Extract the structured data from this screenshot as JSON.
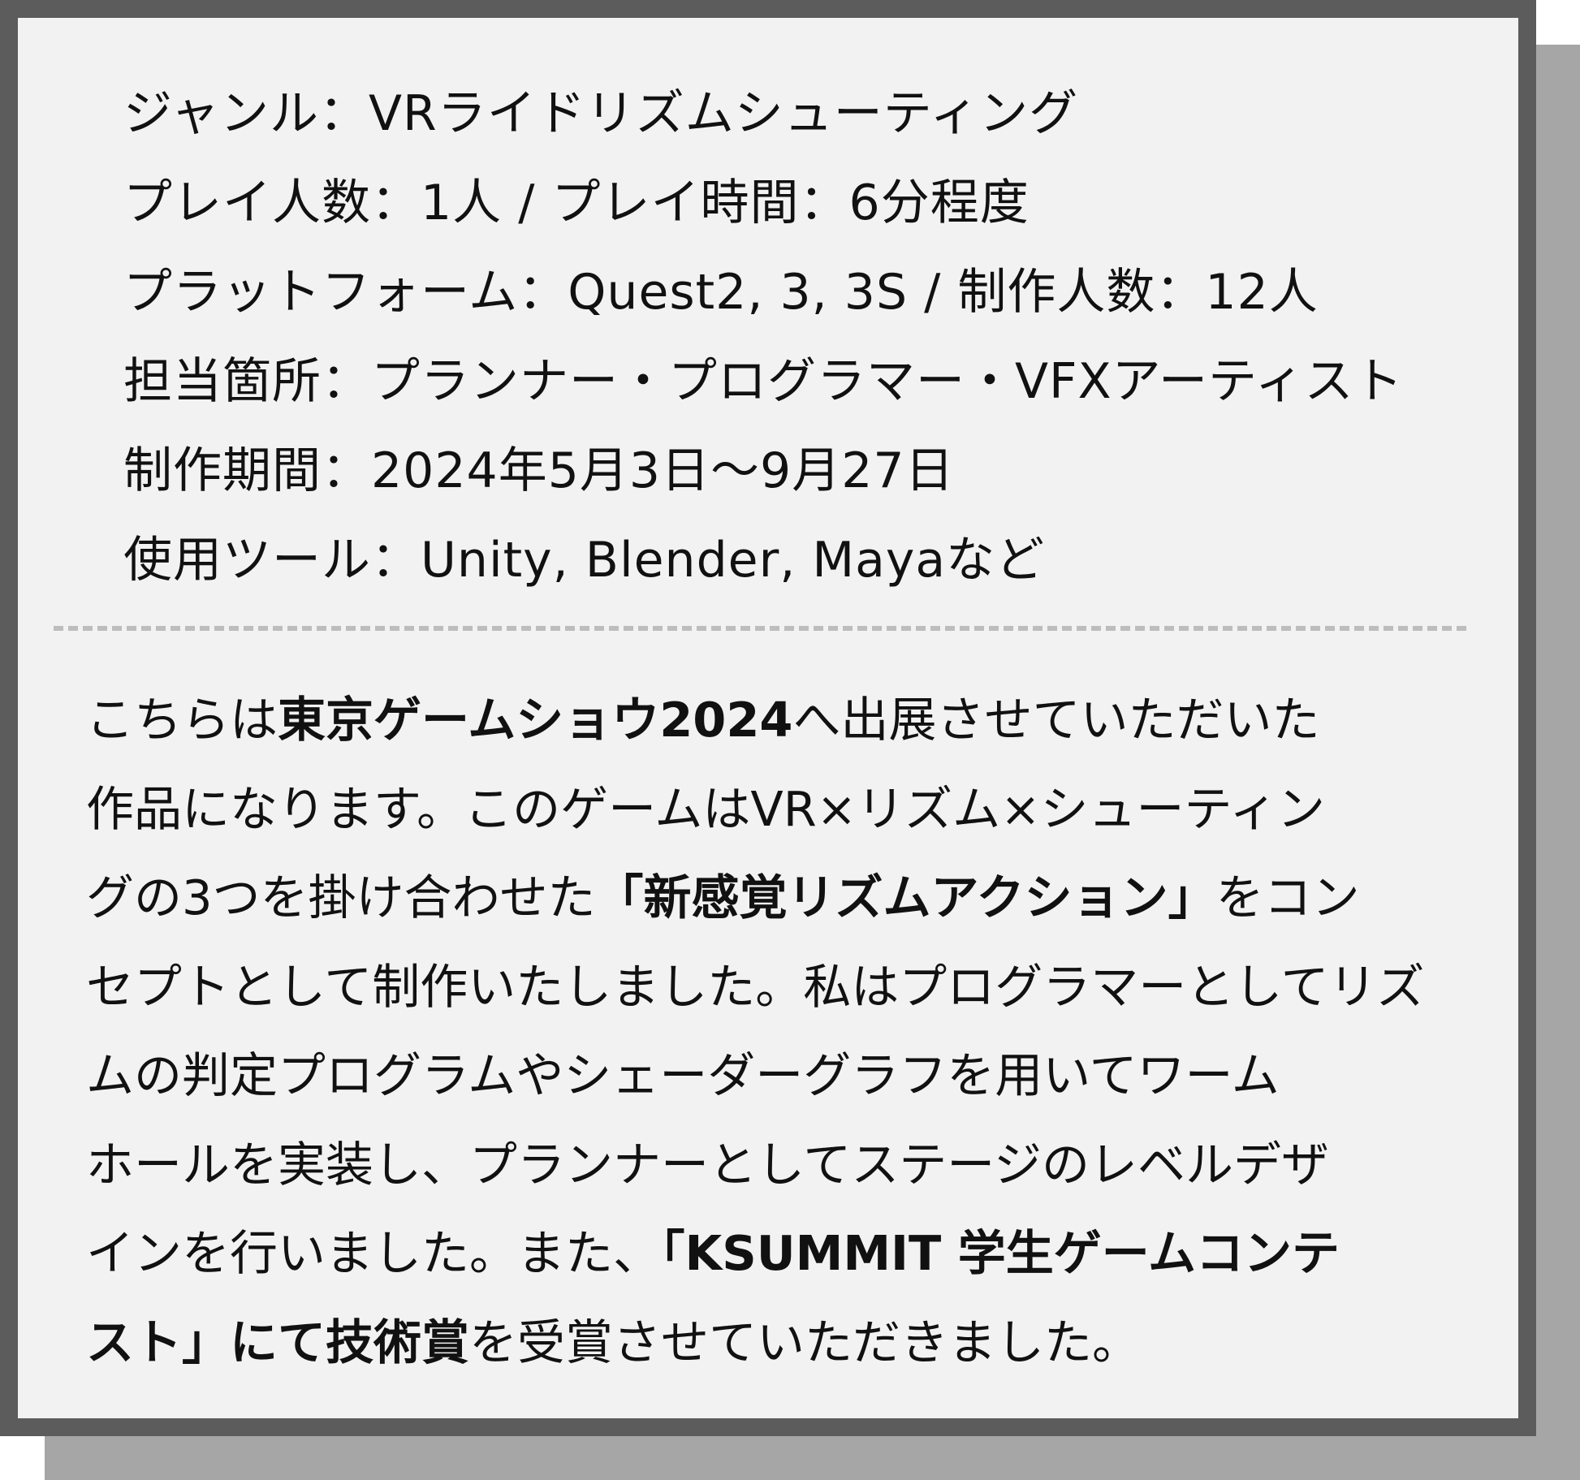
{
  "specs": [
    "ジャンル：VRライドリズムシューティング",
    "プレイ人数：1人 / プレイ時間：6分程度",
    "プラットフォーム：Quest2, 3, 3S / 制作人数：12人",
    "担当箇所：プランナー・プログラマー・VFXアーティスト",
    "制作期間：2024年5月3日～9月27日",
    "使用ツール：Unity, Blender, Mayaなど"
  ],
  "description": {
    "line1": {
      "a": "こちらは",
      "b": "東京ゲームショウ2024",
      "c": "へ出展させていただいた"
    },
    "line2": "作品になります。このゲームはVR×リズム×シューティン",
    "line3": {
      "a": "グの3つを掛け合わせた",
      "b": "「新感覚リズムアクション」",
      "c": "をコン"
    },
    "line4": "セプトとして制作いたしました。私はプログラマーとしてリズ",
    "line5": "ムの判定プログラムやシェーダーグラフを用いてワーム",
    "line6": "ホールを実装し、プランナーとしてステージのレベルデザ",
    "line7": {
      "a": "インを行いました。また、",
      "b": "「KSUMMIT 学生ゲームコンテ"
    },
    "line8": {
      "b": "スト」にて技術賞",
      "c": "を受賞させていただきました。"
    }
  }
}
